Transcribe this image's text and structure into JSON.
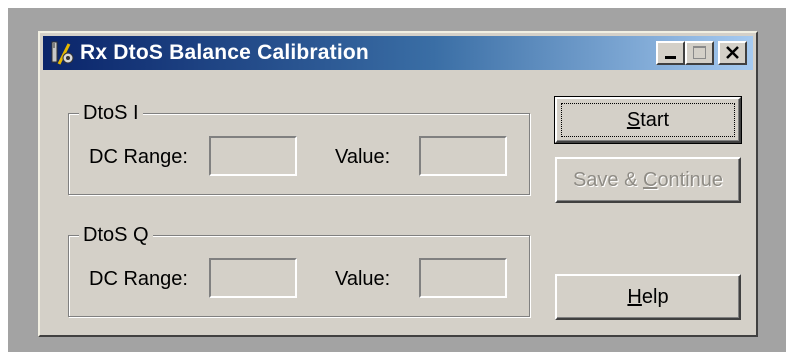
{
  "window": {
    "title": "Rx DtoS Balance Calibration",
    "icon": "calibration-tools-icon",
    "controls": [
      "minimize-icon",
      "maximize-icon",
      "close-icon"
    ]
  },
  "groups": [
    {
      "legend": "DtoS I",
      "dc_range_label": "DC Range:",
      "dc_range_value": "",
      "value_label": "Value:",
      "value_value": ""
    },
    {
      "legend": "DtoS Q",
      "dc_range_label": "DC Range:",
      "dc_range_value": "",
      "value_label": "Value:",
      "value_value": ""
    }
  ],
  "buttons": {
    "start": {
      "pre": "",
      "accel": "S",
      "post": "tart",
      "enabled": true,
      "default": true
    },
    "save_continue": {
      "pre": "Save & ",
      "accel": "C",
      "post": "ontinue",
      "enabled": false
    },
    "help": {
      "pre": "",
      "accel": "H",
      "post": "elp",
      "enabled": true
    }
  },
  "colors": {
    "face": "#d4d0c8",
    "title_start": "#0a246a",
    "title_end": "#a6caf0",
    "disabled_text": "#8f8c85"
  }
}
